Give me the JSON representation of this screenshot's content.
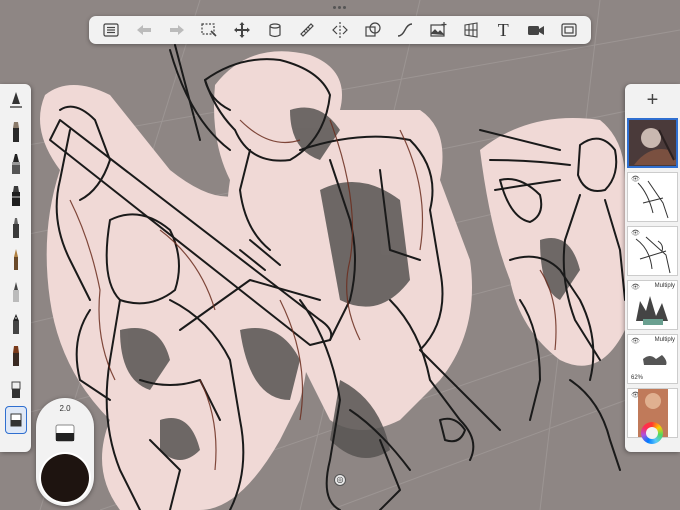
{
  "toolbar": {
    "items": [
      {
        "name": "gallery-icon"
      },
      {
        "name": "undo-icon"
      },
      {
        "name": "redo-icon"
      },
      {
        "name": "selection-icon"
      },
      {
        "name": "transform-icon"
      },
      {
        "name": "fill-icon"
      },
      {
        "name": "ruler-icon"
      },
      {
        "name": "symmetry-icon"
      },
      {
        "name": "shapes-icon"
      },
      {
        "name": "curve-icon"
      },
      {
        "name": "image-icon"
      },
      {
        "name": "perspective-icon"
      },
      {
        "name": "text-icon"
      },
      {
        "name": "time-lapse-icon"
      },
      {
        "name": "fullscreen-icon"
      }
    ],
    "text_label": "T"
  },
  "brush_puck": {
    "size_value": "2.0",
    "color": "#1e1410"
  },
  "layers": {
    "add_label": "+",
    "items": [
      {
        "name": "layer-1",
        "mode": "",
        "opacity": ""
      },
      {
        "name": "layer-2",
        "mode": "",
        "opacity": ""
      },
      {
        "name": "layer-3",
        "mode": "",
        "opacity": ""
      },
      {
        "name": "layer-4",
        "mode": "Multiply",
        "opacity": ""
      },
      {
        "name": "layer-5",
        "mode": "Multiply",
        "opacity": "62%"
      },
      {
        "name": "layer-6",
        "mode": "",
        "opacity": ""
      }
    ]
  },
  "colors": {
    "canvas_bg": "#8e8684",
    "sketch_ink": "#1a1a1a",
    "sketch_red": "#6b2d1e",
    "accent": "#2f6fd0",
    "highlight": "#f0d9d6"
  }
}
